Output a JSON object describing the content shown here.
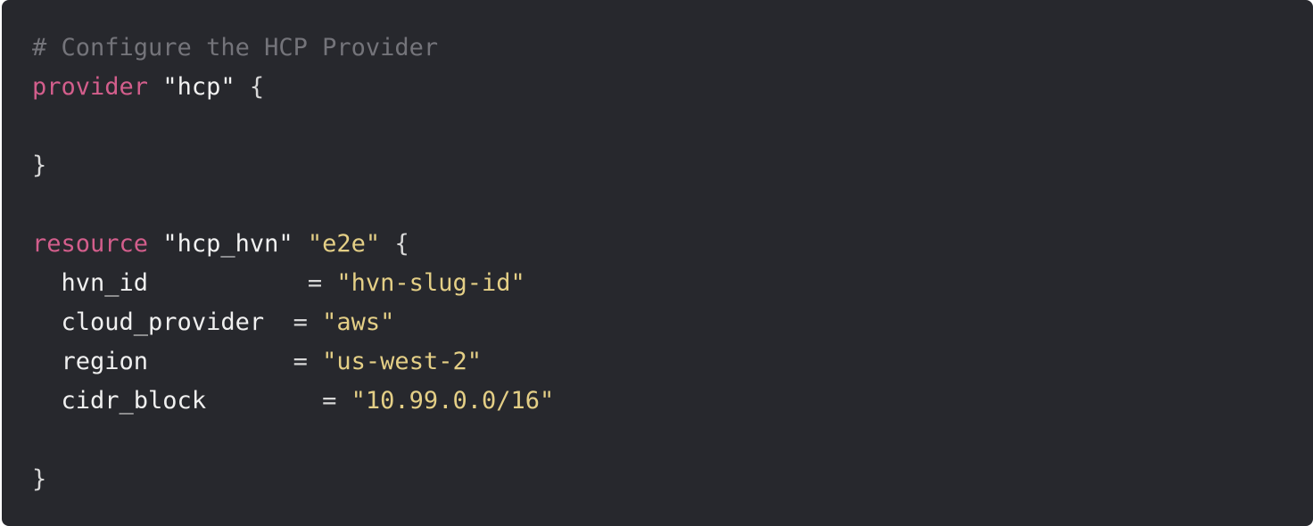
{
  "colors": {
    "background": "#27282d",
    "comment": "#74747a",
    "keyword": "#d35e8c",
    "string_default": "#f2f2f2",
    "string_value": "#e4cf86",
    "text": "#e8e8e8"
  },
  "code": {
    "comment": "# Configure the HCP Provider",
    "provider_block": {
      "keyword": "provider",
      "name": "\"hcp\"",
      "open_brace": "{",
      "close_brace": "}"
    },
    "resource_block": {
      "keyword": "resource",
      "type": "\"hcp_hvn\"",
      "name": "\"e2e\"",
      "open_brace": "{",
      "close_brace": "}",
      "attributes": [
        {
          "key": "hvn_id",
          "spacing": "           ",
          "equals": "=",
          "value": "\"hvn-slug-id\""
        },
        {
          "key": "cloud_provider",
          "spacing": "  ",
          "equals": "=",
          "value": "\"aws\""
        },
        {
          "key": "region",
          "spacing": "          ",
          "equals": "=",
          "value": "\"us-west-2\""
        },
        {
          "key": "cidr_block",
          "spacing": "        ",
          "equals": "=",
          "value": "\"10.99.0.0/16\""
        }
      ]
    }
  }
}
